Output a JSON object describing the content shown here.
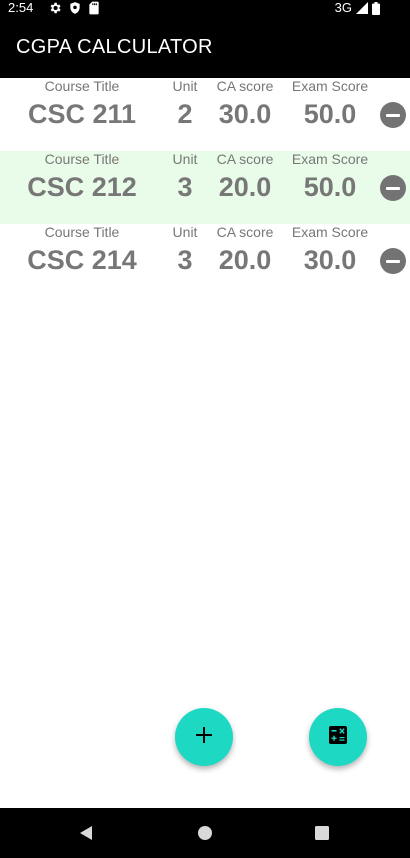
{
  "status_bar": {
    "time": "2:54",
    "network": "3G",
    "icons": [
      "gear-icon",
      "shield-icon",
      "sd-card-icon",
      "signal-icon",
      "battery-icon"
    ]
  },
  "app_bar": {
    "title": "CGPA CALCULATOR",
    "background_color": "#000000"
  },
  "table": {
    "headers": {
      "course_title": "Course Title",
      "unit": "Unit",
      "ca_score": "CA score",
      "exam_score": "Exam Score"
    },
    "rows": [
      {
        "course_title": "CSC 211",
        "unit": "2",
        "ca_score": "30.0",
        "exam_score": "50.0",
        "highlighted": false
      },
      {
        "course_title": "CSC 212",
        "unit": "3",
        "ca_score": "20.0",
        "exam_score": "50.0",
        "highlighted": true
      },
      {
        "course_title": "CSC 214",
        "unit": "3",
        "ca_score": "20.0",
        "exam_score": "30.0",
        "highlighted": false
      }
    ],
    "highlight_color": "#e9fce9",
    "remove_icon": "remove-circle-icon"
  },
  "fabs": {
    "add_icon": "plus-icon",
    "calculate_icon": "calculator-icon",
    "accent_color": "#1dd9c3"
  },
  "nav_bar": {
    "icons": [
      "back-icon",
      "home-icon",
      "recents-icon"
    ]
  }
}
